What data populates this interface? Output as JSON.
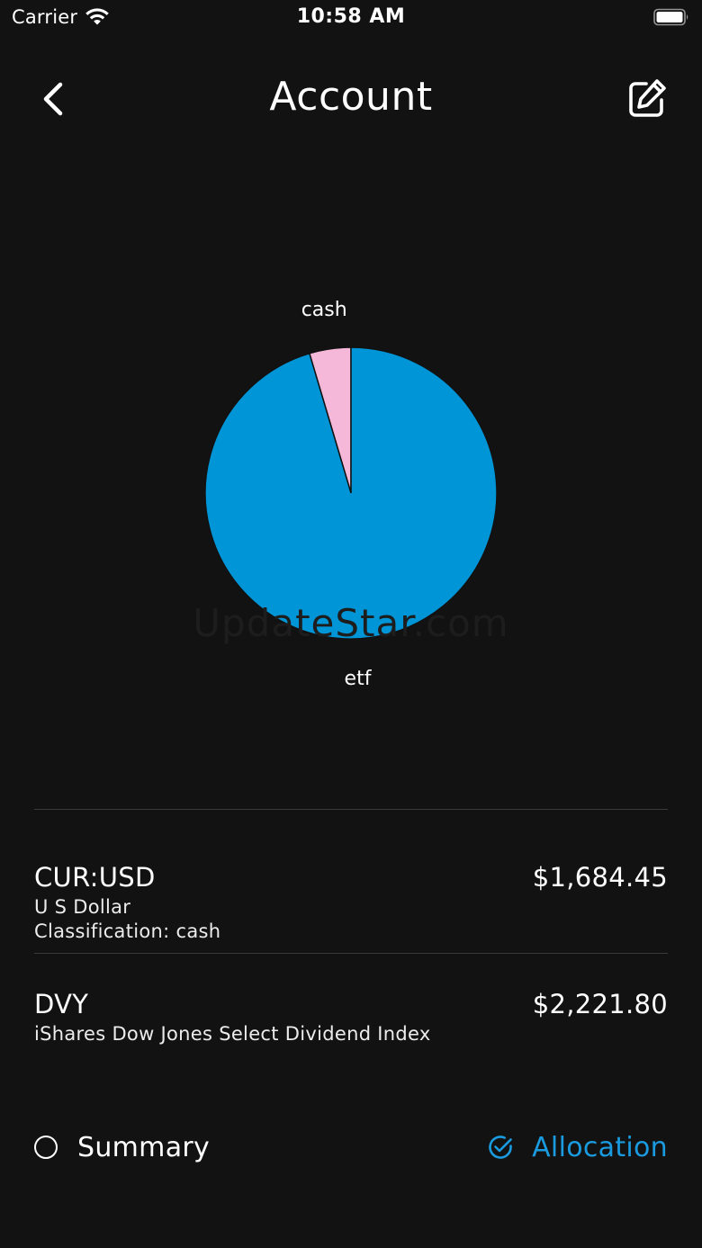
{
  "status_bar": {
    "carrier": "Carrier",
    "time": "10:58 AM"
  },
  "nav": {
    "title": "Account",
    "back_icon": "chevron-left-icon",
    "edit_icon": "edit-icon"
  },
  "chart_data": {
    "type": "pie",
    "slices": [
      {
        "label": "cash",
        "percent": 4.6,
        "color": "#f5b8d8"
      },
      {
        "label": "etf",
        "percent": 95.4,
        "color": "#0095d6"
      }
    ],
    "title": "",
    "legend": "none"
  },
  "watermark": "UpdateStar.com",
  "holdings": [
    {
      "symbol": "CUR:USD",
      "name": "U S Dollar",
      "classification": "Classification: cash",
      "value": "$1,684.45"
    },
    {
      "symbol": "DVY",
      "name": "iShares Dow Jones Select Dividend Index",
      "value": "$2,221.80"
    }
  ],
  "view_toggle": {
    "summary_label": "Summary",
    "allocation_label": "Allocation",
    "selected": "Allocation",
    "accent_color": "#1a9be0"
  }
}
